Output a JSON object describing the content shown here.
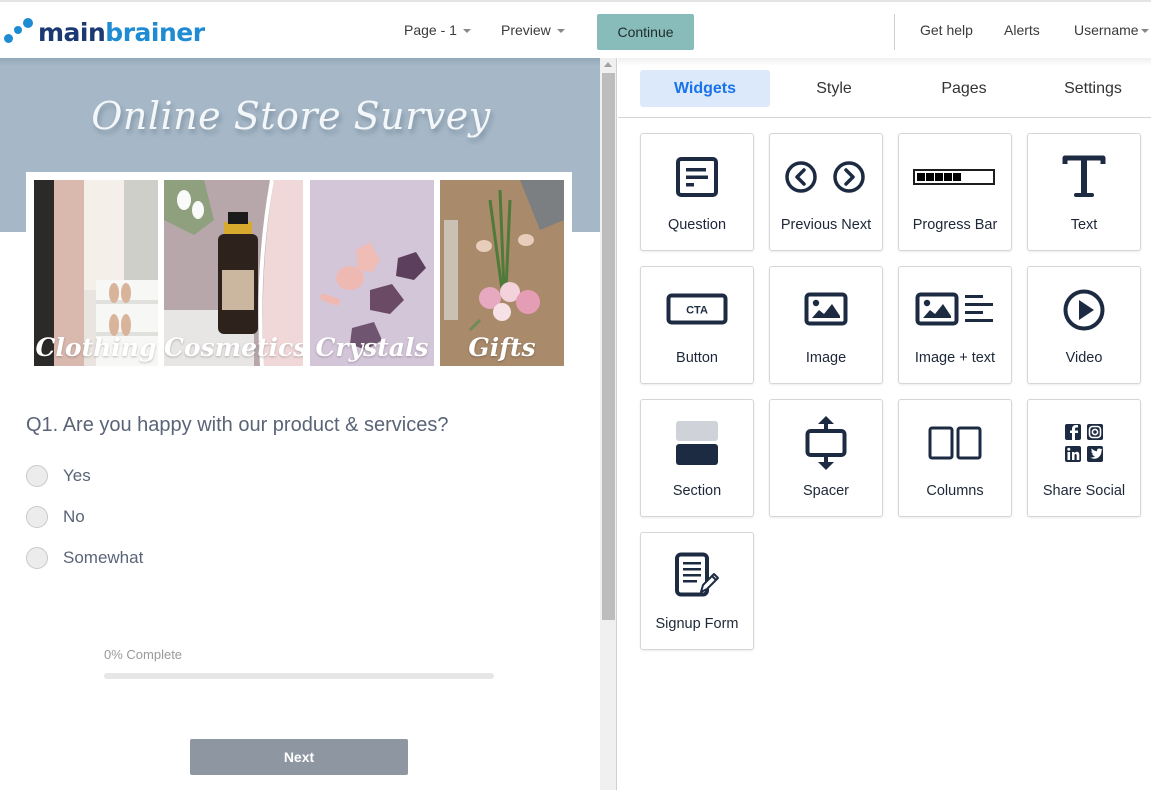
{
  "header": {
    "logo": {
      "part1": "main",
      "part2": "brainer"
    },
    "page_dropdown": "Page - 1",
    "preview_dropdown": "Preview",
    "continue_label": "Continue",
    "get_help": "Get help",
    "alerts": "Alerts",
    "username": "Username"
  },
  "survey": {
    "title": "Online Store Survey",
    "categories": [
      {
        "label": "Clothing"
      },
      {
        "label": "Cosmetics"
      },
      {
        "label": "Crystals"
      },
      {
        "label": "Gifts"
      }
    ],
    "question": "Q1. Are you happy with our product & services?",
    "options": [
      {
        "label": "Yes",
        "selected": false
      },
      {
        "label": "No",
        "selected": false
      },
      {
        "label": "Somewhat",
        "selected": false
      }
    ],
    "progress": {
      "label": "0% Complete",
      "percent": 0
    },
    "next_label": "Next"
  },
  "panel": {
    "tabs": [
      {
        "label": "Widgets",
        "active": true
      },
      {
        "label": "Style",
        "active": false
      },
      {
        "label": "Pages",
        "active": false
      },
      {
        "label": "Settings",
        "active": false
      }
    ],
    "widgets": [
      {
        "label": "Question",
        "icon": "question-icon"
      },
      {
        "label": "Previous Next",
        "icon": "previous-next-icon"
      },
      {
        "label": "Progress Bar",
        "icon": "progress-bar-icon"
      },
      {
        "label": "Text",
        "icon": "text-icon"
      },
      {
        "label": "Button",
        "icon": "cta-button-icon",
        "icon_text": "CTA"
      },
      {
        "label": "Image",
        "icon": "image-icon"
      },
      {
        "label": "Image + text",
        "icon": "image-text-icon"
      },
      {
        "label": "Video",
        "icon": "video-play-icon"
      },
      {
        "label": "Section",
        "icon": "section-icon"
      },
      {
        "label": "Spacer",
        "icon": "spacer-icon"
      },
      {
        "label": "Columns",
        "icon": "columns-icon"
      },
      {
        "label": "Share Social",
        "icon": "share-social-icon"
      },
      {
        "label": "Signup Form",
        "icon": "signup-form-icon"
      }
    ]
  },
  "colors": {
    "accent": "#1a73e8",
    "continue_bg": "#88bcbb",
    "banner_bg": "#a6b8c7",
    "icon_dark": "#1d2b42",
    "next_bg": "#8e96a1"
  }
}
